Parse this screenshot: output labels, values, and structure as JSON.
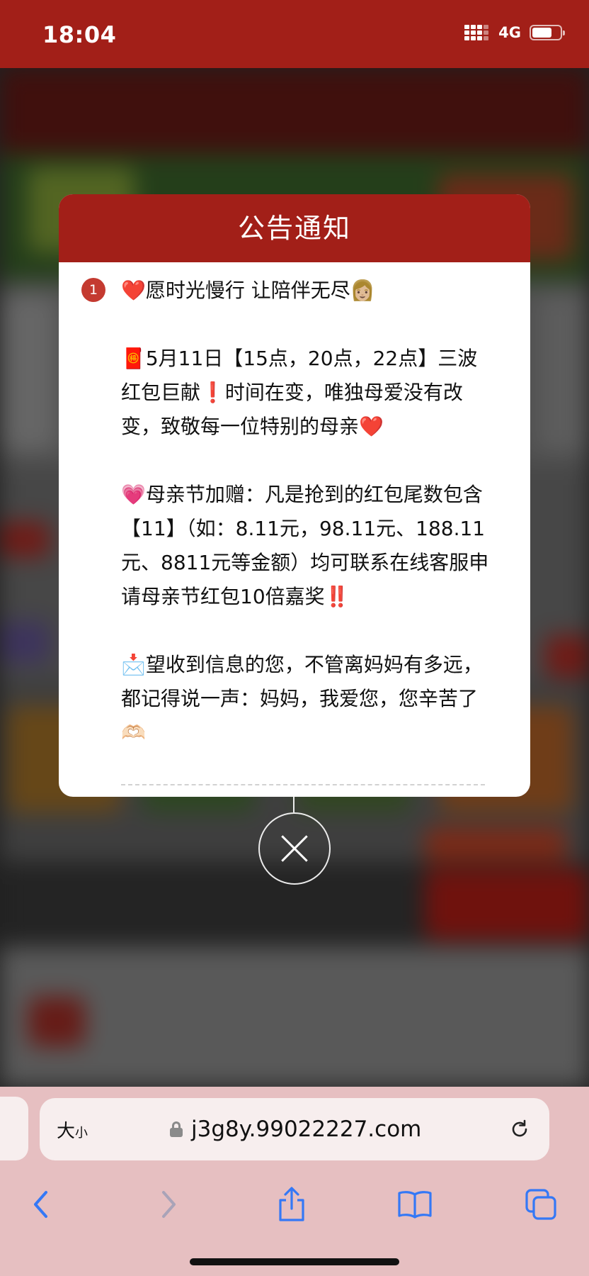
{
  "status_bar": {
    "time": "18:04",
    "network": "4G",
    "icons": [
      "signal-icon",
      "battery-icon"
    ]
  },
  "notice": {
    "title": "公告通知",
    "index": "1",
    "paragraphs": [
      "❤️愿时光慢行 让陪伴无尽👩🏼",
      "🧧5月11日【15点，20点，22点】三波红包巨献❗时间在变，唯独母爱没有改变，致敬每一位特别的母亲❤️",
      "💗母亲节加赠：凡是抢到的红包尾数包含【11】（如：8.11元，98.11元、188.11元、8811元等金额）均可联系在线客服申请母亲节红包10倍嘉奖‼️",
      "📩望收到信息的您，不管离妈妈有多远，都记得说一声：妈妈，我爱您，您辛苦了🫶🏻"
    ]
  },
  "close": {
    "icon": "close-icon"
  },
  "browser": {
    "text_size_label": "大",
    "text_size_small": "小",
    "url": "j3g8y.99022227.com",
    "toolbar_icons": [
      "back-icon",
      "forward-icon",
      "share-icon",
      "bookmarks-icon",
      "tabs-icon"
    ]
  },
  "colors": {
    "brand_red": "#a21f18",
    "browser_chrome": "#e6bfc1",
    "ios_blue": "#3478f6"
  }
}
